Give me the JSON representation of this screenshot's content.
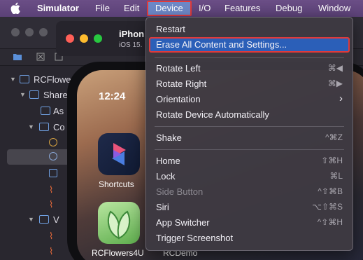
{
  "menubar": {
    "app_name": "Simulator",
    "items": [
      "File",
      "Edit",
      "Device",
      "I/O",
      "Features",
      "Debug",
      "Window"
    ],
    "selected": "Device"
  },
  "xcode": {
    "tree": [
      {
        "label": "RCFlowers",
        "level": 0
      },
      {
        "label": "Share",
        "level": 1
      },
      {
        "label": "As",
        "level": 2
      },
      {
        "label": "Co",
        "level": 1
      },
      {
        "label": "V",
        "level": 1
      }
    ]
  },
  "simulator": {
    "title": "iPhon",
    "os": "iOS 15.",
    "clock": "12:24",
    "apps": [
      {
        "label": "Shortcuts"
      },
      {
        "label": "RCFlowers4U"
      },
      {
        "label": "RCDemo"
      }
    ]
  },
  "menu": {
    "sections": [
      [
        {
          "label": "Restart",
          "shortcut": "",
          "enabled": true,
          "highlighted": false
        },
        {
          "label": "Erase All Content and Settings...",
          "shortcut": "",
          "enabled": true,
          "highlighted": true
        }
      ],
      [
        {
          "label": "Rotate Left",
          "shortcut": "⌘◀",
          "enabled": true,
          "highlighted": false
        },
        {
          "label": "Rotate Right",
          "shortcut": "⌘▶",
          "enabled": true,
          "highlighted": false
        },
        {
          "label": "Orientation",
          "shortcut": "›",
          "enabled": true,
          "highlighted": false
        },
        {
          "label": "Rotate Device Automatically",
          "shortcut": "",
          "enabled": true,
          "highlighted": false
        }
      ],
      [
        {
          "label": "Shake",
          "shortcut": "^⌘Z",
          "enabled": true,
          "highlighted": false
        }
      ],
      [
        {
          "label": "Home",
          "shortcut": "⇧⌘H",
          "enabled": true,
          "highlighted": false
        },
        {
          "label": "Lock",
          "shortcut": "⌘L",
          "enabled": true,
          "highlighted": false
        },
        {
          "label": "Side Button",
          "shortcut": "^⇧⌘B",
          "enabled": false,
          "highlighted": false
        },
        {
          "label": "Siri",
          "shortcut": "⌥⇧⌘S",
          "enabled": true,
          "highlighted": false
        },
        {
          "label": "App Switcher",
          "shortcut": "^⇧⌘H",
          "enabled": true,
          "highlighted": false
        },
        {
          "label": "Trigger Screenshot",
          "shortcut": "",
          "enabled": true,
          "highlighted": false
        }
      ]
    ]
  },
  "colors": {
    "menubar": "#5b4177",
    "highlight": "#2b5fb8",
    "annotation": "#e03a3a"
  }
}
